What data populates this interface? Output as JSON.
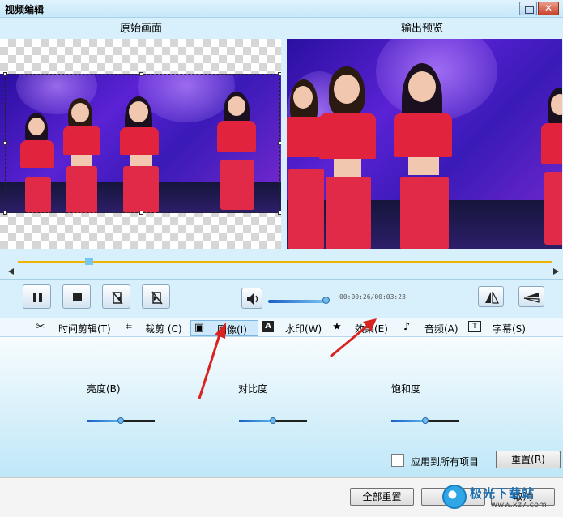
{
  "window": {
    "title": "视频编辑",
    "close_glyph": "✕"
  },
  "preview": {
    "left_label": "原始画面",
    "right_label": "输出预览"
  },
  "playback": {
    "time": "00:00:26/00:03:23"
  },
  "tabs": [
    {
      "label": "时间剪辑(T)",
      "icon": "scissors-icon"
    },
    {
      "label": "裁剪 (C)",
      "icon": "crop-icon"
    },
    {
      "label": "图像(I)",
      "icon": "image-icon",
      "active": true
    },
    {
      "label": "水印(W)",
      "icon": "watermark-icon"
    },
    {
      "label": "效果(E)",
      "icon": "star-icon"
    },
    {
      "label": "音频(A)",
      "icon": "music-note-icon"
    },
    {
      "label": "字幕(S)",
      "icon": "subtitle-icon"
    }
  ],
  "image_panel": {
    "brightness_label": "亮度(B)",
    "contrast_label": "对比度",
    "saturation_label": "饱和度",
    "brightness": 0.5,
    "contrast": 0.5,
    "saturation": 0.5,
    "apply_all_label": "应用到所有项目",
    "apply_all_checked": false,
    "reset_label": "重置(R)"
  },
  "footer": {
    "reset_all_label": "全部重置",
    "ok_label": "确定",
    "cancel_label": "取消"
  },
  "watermark": {
    "name": "极光下载站",
    "url": "www.xz7.com"
  },
  "colors": {
    "accent": "#3a8fd8",
    "timeline": "#f0b400",
    "annotation_arrow": "#d8231f"
  }
}
